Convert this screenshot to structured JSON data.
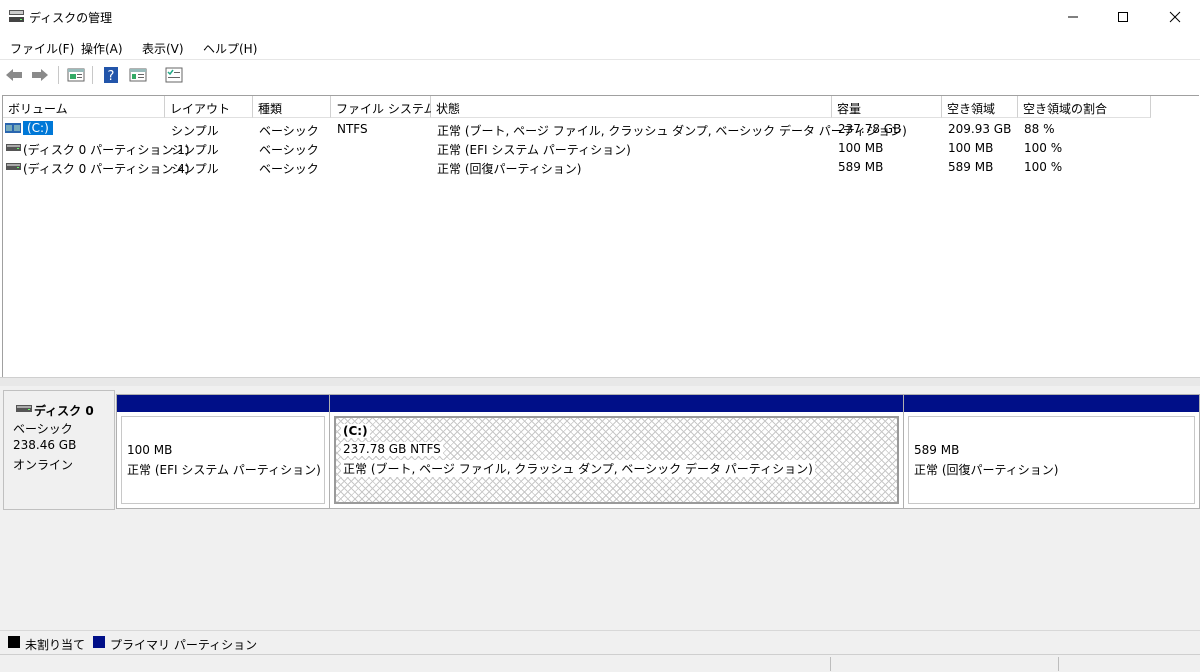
{
  "window": {
    "title": "ディスクの管理"
  },
  "menu": [
    "ファイル(F)",
    "操作(A)",
    "表示(V)",
    "ヘルプ(H)"
  ],
  "toolbar_icons": [
    "back-icon",
    "forward-icon",
    "disk-list-icon",
    "help-icon",
    "properties-icon",
    "settings-icon"
  ],
  "volume_list": {
    "headers": [
      "ボリューム",
      "レイアウト",
      "種類",
      "ファイル システム",
      "状態",
      "容量",
      "空き領域",
      "空き領域の割合"
    ],
    "rows": [
      {
        "volume": "(C:)",
        "layout": "シンプル",
        "type": "ベーシック",
        "fs": "NTFS",
        "status": "正常 (ブート, ページ ファイル, クラッシュ ダンプ, ベーシック データ パーティション)",
        "capacity": "237.78 GB",
        "free": "209.93 GB",
        "pct": "88 %"
      },
      {
        "volume": "(ディスク 0 パーティション 1)",
        "layout": "シンプル",
        "type": "ベーシック",
        "fs": "",
        "status": "正常 (EFI システム パーティション)",
        "capacity": "100 MB",
        "free": "100 MB",
        "pct": "100 %"
      },
      {
        "volume": "(ディスク 0 パーティション 4)",
        "layout": "シンプル",
        "type": "ベーシック",
        "fs": "",
        "status": "正常 (回復パーティション)",
        "capacity": "589 MB",
        "free": "589 MB",
        "pct": "100 %"
      }
    ]
  },
  "disk": {
    "name": "ディスク 0",
    "type": "ベーシック",
    "size": "238.46 GB",
    "state": "オンライン",
    "partitions": [
      {
        "title": "",
        "size": "100 MB",
        "status": "正常 (EFI システム パーティション)"
      },
      {
        "title": "(C:)",
        "size": "237.78 GB NTFS",
        "status": "正常 (ブート, ページ ファイル, クラッシュ ダンプ, ベーシック データ パーティション)"
      },
      {
        "title": "",
        "size": "589 MB",
        "status": "正常 (回復パーティション)"
      }
    ]
  },
  "legend": [
    {
      "label": "未割り当て",
      "color": "#000000"
    },
    {
      "label": "プライマリ パーティション",
      "color": "#000f88"
    }
  ],
  "colors": {
    "partition_bar": "#000f88",
    "selection": "#0078d7"
  }
}
